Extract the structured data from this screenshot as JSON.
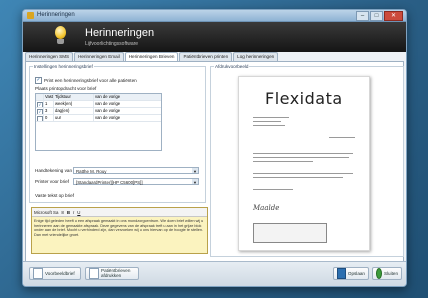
{
  "window": {
    "title": "Herinneringen"
  },
  "header": {
    "title": "Herinneringen",
    "subtitle": "Lijfvoorlichtingssoftware"
  },
  "tabs": [
    "Herinneringen SMS",
    "Herinneringen Email",
    "Herinneringen Brieven",
    "Patiëntbrieven printen",
    "Log herinneringen"
  ],
  "active_tab": 2,
  "settings": {
    "legend": "Instellingen herinneringsbrief",
    "print_all_label": "Print een herinneringsbrief voor alle patiënten",
    "priority_label": "Plaats printopdracht voor brief",
    "columns": [
      "",
      "Vastel",
      "Tijdstuur",
      "van de vorige"
    ],
    "rows": [
      {
        "checked": true,
        "num": "1",
        "unit": "week(en)",
        "ref": "van de vorige"
      },
      {
        "checked": true,
        "num": "3",
        "unit": "dag(en)",
        "ref": "van de vorige"
      },
      {
        "checked": false,
        "num": "0",
        "unit": "uur",
        "ref": "van de vorige"
      }
    ],
    "signature_label": "Handtekening van",
    "signature_value": "Ratthe M. Rouy",
    "printer_label": "Printer voor brief",
    "printer_value": "[StandaardPrinter][HP C5600[PS]]",
    "text_label": "Vaste tekst op brief"
  },
  "editor": {
    "font": "Microsoft Sa",
    "size": "8",
    "tools": [
      "B",
      "I",
      "U"
    ],
    "text": "Enige tijd geleden heeft u een afspraak gemaakt in ons mondzorgcentrum. We doen brief willen wij u herinneren aan de gemaakte afspraak. Deze gegevens van de afspraak treft u aan in het grijze blok onder aan de brief. Mocht u verhinderd zijn, dan verzoeken wij u ons hiervan op de hoogte te stellen. Dan met vriendelijke groet."
  },
  "preview": {
    "legend": "Afdrukvoorbeeld",
    "logo": "Flexidata",
    "signature": "Maalde"
  },
  "footer": {
    "btn_voorbeeld": "Voorbeeldbrief",
    "btn_patient_line1": "Patiëntbrieven",
    "btn_patient_line2": "afdrukken",
    "btn_save": "Opslaan",
    "btn_close": "Sluiten"
  }
}
